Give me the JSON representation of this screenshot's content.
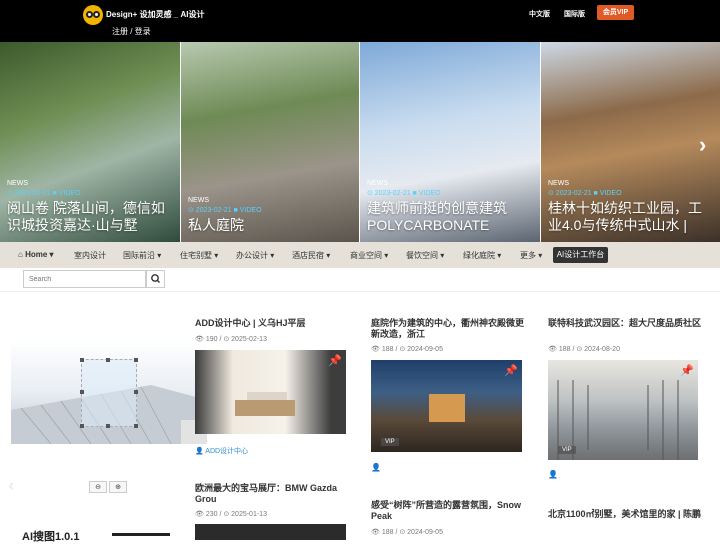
{
  "header": {
    "brand": "Design+ 设加灵感 _ AI设计",
    "auth": "注册 / 登录",
    "lang_cn": "中文版",
    "lang_intl": "国际版",
    "vip_label": "会员VIP"
  },
  "slides": [
    {
      "tag": "NEWS",
      "meta": "⊙ 2023-02-21 ■ VIDEO",
      "title": "阅山卷 院落山间，德信如识城投资嘉达·山与墅"
    },
    {
      "tag": "NEWS",
      "meta": "⊙ 2023-02-21 ■ VIDEO",
      "title": "私人庭院"
    },
    {
      "tag": "NEWS",
      "meta": "⊙ 2023-02-21 ■ VIDEO",
      "title": "建筑师前挺的创意建筑POLYCARBONATE"
    },
    {
      "tag": "NEWS",
      "meta": "⊙ 2023-02-21 ■ VIDEO",
      "title": "桂林十如纺织工业园，工业4.0与传统中式山水 |"
    }
  ],
  "nav": {
    "home": "Home",
    "items": [
      "室内设计",
      "国际前沿",
      "住宅别墅",
      "办公设计",
      "酒店民宿",
      "商业空间",
      "餐饮空间",
      "绿化庭院",
      "更多"
    ],
    "ai_button": "AI设计工作台"
  },
  "search": {
    "placeholder": "Search"
  },
  "left": {
    "ai_title": "AI搜图1.0.1",
    "zoom_out": "⊖",
    "zoom_in": "⊕"
  },
  "cards": [
    {
      "title": "ADD设计中心 | 义乌HJ平层",
      "meta": "👁 190 / ⊙ 2025-02-13",
      "author": "ADD设计中心"
    },
    {
      "title": "庭院作为建筑的中心，衢州神农殿微更新改造，浙江",
      "meta": "👁 188 / ⊙ 2024-09-05",
      "vip": "VIP"
    },
    {
      "title": "联特科技武汉园区：超大尺度品质社区",
      "meta": "👁 188 / ⊙ 2024-08-20",
      "vip": "VIP"
    },
    {
      "title": "欧洲最大的宝马展厅：BMW Gazda Grou",
      "meta": "👁 230 / ⊙ 2025-01-13"
    },
    {
      "title": "感受“树阵”所营造的露营氛围，Snow Peak",
      "meta": "👁 188 / ⊙ 2024-09-05"
    },
    {
      "title": "北京1100㎡别墅，美术馆里的家 | 陈鹏",
      "meta": ""
    }
  ]
}
